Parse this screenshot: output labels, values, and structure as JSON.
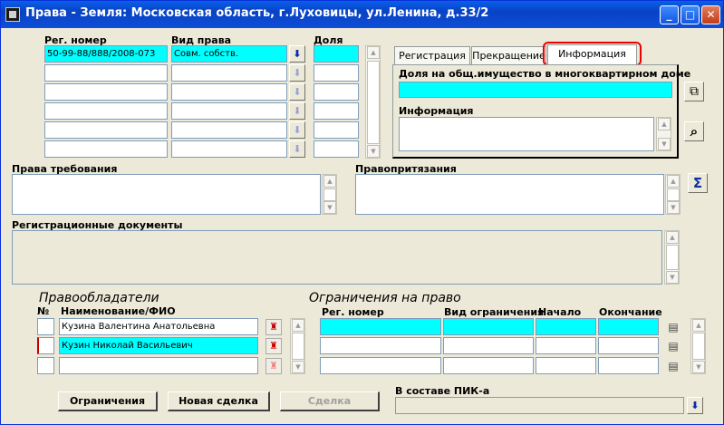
{
  "window": {
    "title": "Права - Земля: Московская область, г.Луховицы, ул.Ленина, д.33/2",
    "min": "_",
    "max": "□",
    "close": "✕"
  },
  "rights": {
    "col_reg": "Рег. номер",
    "col_kind": "Вид права",
    "col_share": "Доля",
    "row1_reg": "50-99-88/888/2008-073",
    "row1_kind": "Совм. собств.",
    "row1_share": ""
  },
  "tabs": {
    "t1": "Регистрация",
    "t2": "Прекращение",
    "t3": "Информация"
  },
  "info": {
    "share_label": "Доля на общ.имущество в многоквартирном доме",
    "share_value": "",
    "info_label": "Информация",
    "info_value": ""
  },
  "claims": {
    "label": "Права требования",
    "value": ""
  },
  "pretensions": {
    "label": "Правопритязания",
    "value": ""
  },
  "regdocs": {
    "label": "Регистрационные документы",
    "value": ""
  },
  "holders": {
    "title": "Правообладатели",
    "col_num": "№",
    "col_name": "Наименование/ФИО",
    "r1": "Кузина Валентина Анатольевна",
    "r2": "Кузин Николай Васильевич",
    "r3": ""
  },
  "limits": {
    "title": "Ограничения на право",
    "col_reg": "Рег. номер",
    "col_kind": "Вид ограничения",
    "col_start": "Начало",
    "col_end": "Окончание"
  },
  "buttons": {
    "limits": "Ограничения",
    "new_deal": "Новая сделка",
    "deal": "Сделка"
  },
  "pik": {
    "label": "В составе ПИК-а",
    "value": ""
  },
  "icons": {
    "copy": "⧉",
    "search": "⌕",
    "sum": "Σ",
    "download": "⬇",
    "person": "♜",
    "doc": "▤"
  },
  "colors": {
    "highlight": "#00FFFF",
    "title_blue": "#0A5FE8",
    "tab_marker": "#EE0000"
  }
}
